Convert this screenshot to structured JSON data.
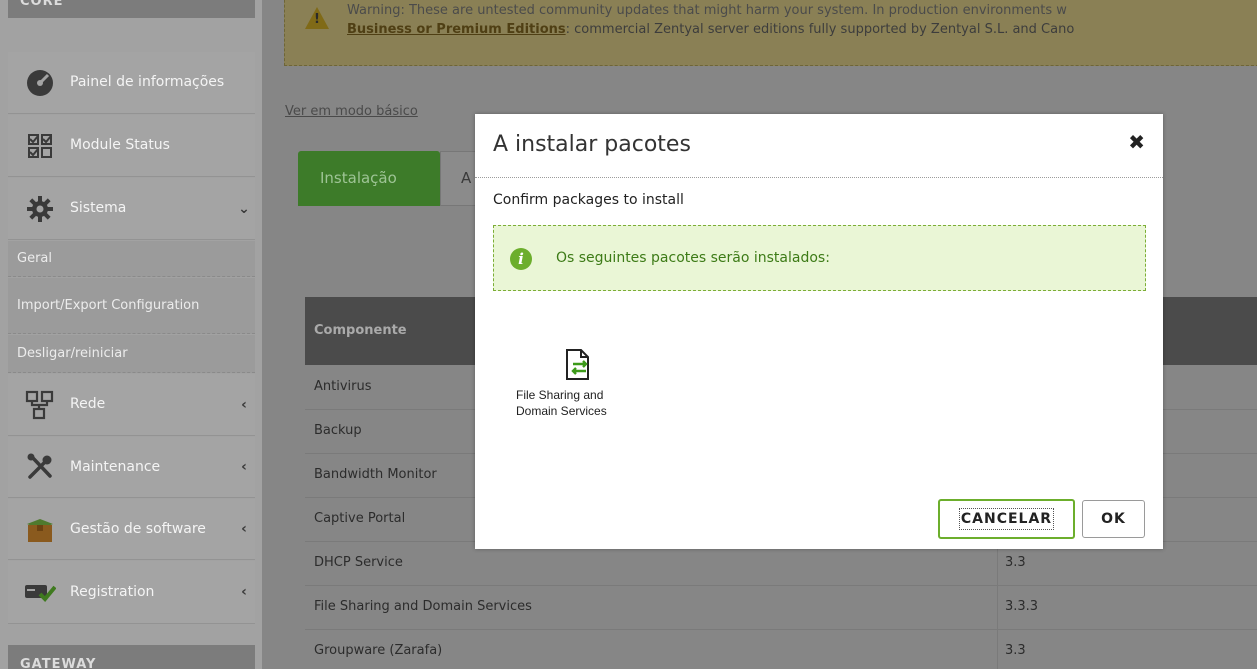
{
  "sidebar": {
    "section_core": "CORE",
    "section_gateway": "GATEWAY",
    "items": [
      {
        "label": "Painel de informações",
        "icon": "dashboard-icon"
      },
      {
        "label": "Module Status",
        "icon": "checkbox-grid-icon"
      },
      {
        "label": "Sistema",
        "icon": "gear-icon",
        "chevron": "⌄"
      },
      {
        "label": "Rede",
        "icon": "network-icon",
        "chevron": "‹"
      },
      {
        "label": "Maintenance",
        "icon": "tools-icon",
        "chevron": "‹"
      },
      {
        "label": "Gestão de software",
        "icon": "software-box-icon",
        "chevron": "‹"
      },
      {
        "label": "Registration",
        "icon": "registration-icon",
        "chevron": "‹"
      }
    ],
    "sistema_sub": [
      "Geral",
      "Import/Export Configuration",
      "Desligar/reiniciar"
    ]
  },
  "main": {
    "warning_line1": "Warning: These are untested community updates that might harm your system. In production environments w",
    "warning_link": "Business or Premium Editions",
    "warning_line2_rest": ": commercial Zentyal server editions fully supported by Zentyal S.L. and Cano",
    "basic_mode_link": "Ver em modo básico",
    "tab_active": "Instalação",
    "tab_other": "A",
    "table_header": "Componente",
    "rows": [
      {
        "name": "Antivirus",
        "version": ""
      },
      {
        "name": "Backup",
        "version": ""
      },
      {
        "name": "Bandwidth Monitor",
        "version": ""
      },
      {
        "name": "Captive Portal",
        "version": ""
      },
      {
        "name": "DHCP Service",
        "version": "3.3"
      },
      {
        "name": "File Sharing and Domain Services",
        "version": "3.3.3"
      },
      {
        "name": "Groupware (Zarafa)",
        "version": "3.3"
      }
    ]
  },
  "modal": {
    "title": "A instalar pacotes",
    "close_glyph": "✖",
    "subtitle": "Confirm packages to install",
    "info_text": "Os seguintes pacotes serão instalados:",
    "package_label_1": "File Sharing and",
    "package_label_2": "Domain Services",
    "cancel_label": "CANCELAR",
    "ok_label": "OK"
  },
  "colors": {
    "accent_green": "#6cae2c",
    "info_bg": "#eaf6d6",
    "overlay_gray": "#868686"
  }
}
